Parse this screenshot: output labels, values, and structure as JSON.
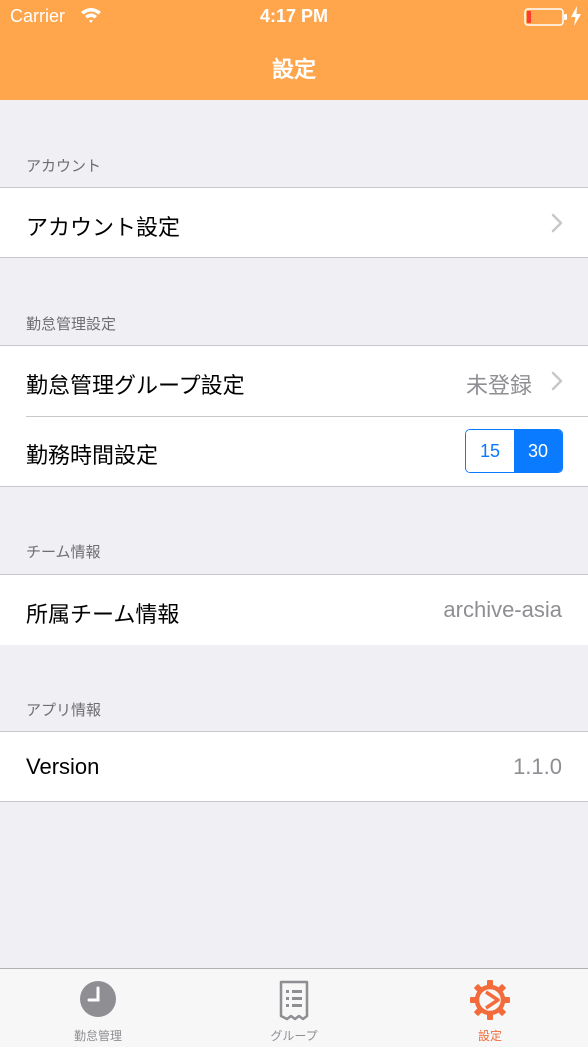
{
  "status_bar": {
    "carrier": "Carrier",
    "time": "4:17 PM"
  },
  "nav": {
    "title": "設定"
  },
  "sections": {
    "account": {
      "header": "アカウント",
      "rows": [
        {
          "label": "アカウント設定"
        }
      ]
    },
    "attendance": {
      "header": "勤怠管理設定",
      "group_row": {
        "label": "勤怠管理グループ設定",
        "value": "未登録"
      },
      "time_row": {
        "label": "勤務時間設定",
        "options": [
          "15",
          "30"
        ],
        "selected": "30"
      }
    },
    "team": {
      "header": "チーム情報",
      "row": {
        "label": "所属チーム情報",
        "value": "archive-asia"
      }
    },
    "app": {
      "header": "アプリ情報",
      "row": {
        "label": "Version",
        "value": "1.1.0"
      }
    }
  },
  "tab_bar": {
    "items": [
      {
        "label": "勤怠管理",
        "icon": "clock-icon",
        "active": false
      },
      {
        "label": "グループ",
        "icon": "document-list-icon",
        "active": false
      },
      {
        "label": "設定",
        "icon": "gear-icon",
        "active": true
      }
    ]
  },
  "colors": {
    "header": "#ffa64d",
    "accent_blue": "#0a7afe",
    "tab_active": "#f26b3a",
    "background": "#efeff4"
  }
}
